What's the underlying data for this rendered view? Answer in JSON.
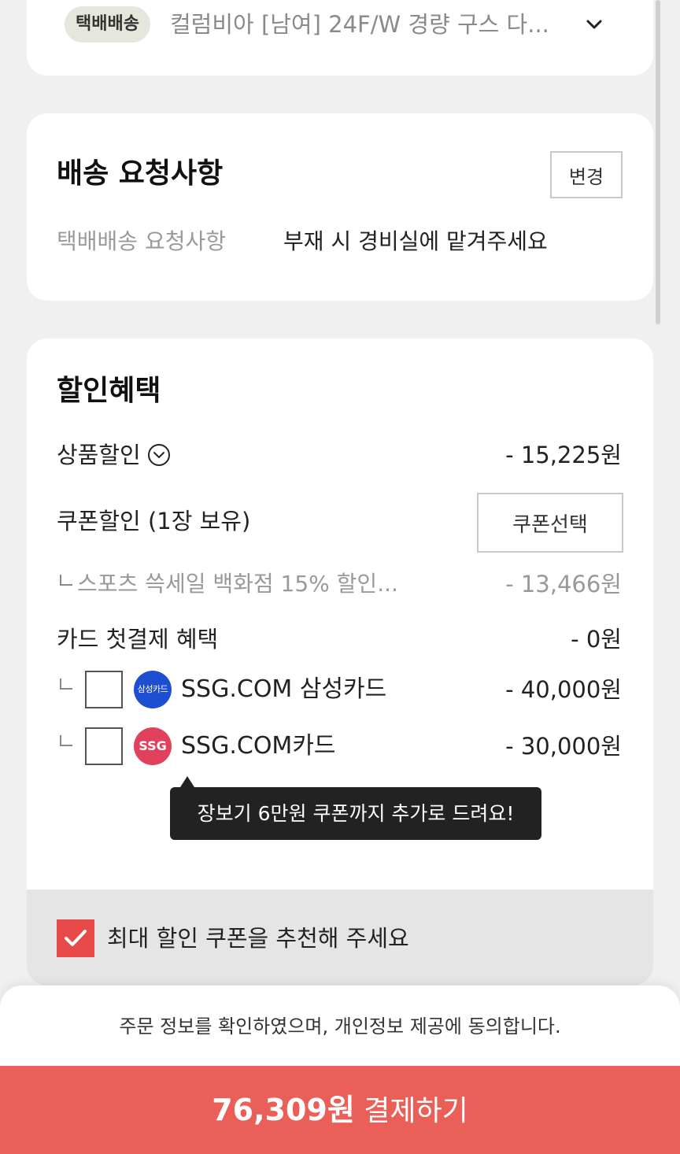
{
  "product": {
    "badge": "택배배송",
    "name": "컬럼비아 [남여] 24F/W 경량 구스 다..."
  },
  "delivery": {
    "title": "배송 요청사항",
    "change_button": "변경",
    "request_label": "택배배송 요청사항",
    "request_value": "부재 시 경비실에 맡겨주세요"
  },
  "discount": {
    "title": "할인혜택",
    "product_discount": {
      "label": "상품할인",
      "amount": "- 15,225원"
    },
    "coupon_discount": {
      "label": "쿠폰할인 (1장 보유)",
      "button": "쿠폰선택"
    },
    "coupon_item": {
      "label": "스포츠 쓱세일 백화점 15% 할인...",
      "amount": "- 13,466원"
    },
    "card_first": {
      "label": "카드 첫결제 혜택",
      "amount": "- 0원"
    },
    "cards": [
      {
        "logo_text": "삼성카드",
        "name": "SSG.COM 삼성카드",
        "amount": "- 40,000원",
        "logo_color": "#1f4fd1"
      },
      {
        "logo_text": "SSG",
        "name": "SSG.COM카드",
        "amount": "- 30,000원",
        "logo_color": "#e2415d"
      }
    ],
    "tooltip": "장보기 6만원 쿠폰까지 추가로 드려요!",
    "recommend_label": "최대 할인 쿠폰을 추천해 주세요"
  },
  "footer": {
    "consent": "주문 정보를 확인하였으며, 개인정보 제공에 동의합니다.",
    "pay_amount": "76,309원",
    "pay_label": "결제하기"
  },
  "colors": {
    "accent": "#ea5f58",
    "check": "#e84a4a"
  }
}
